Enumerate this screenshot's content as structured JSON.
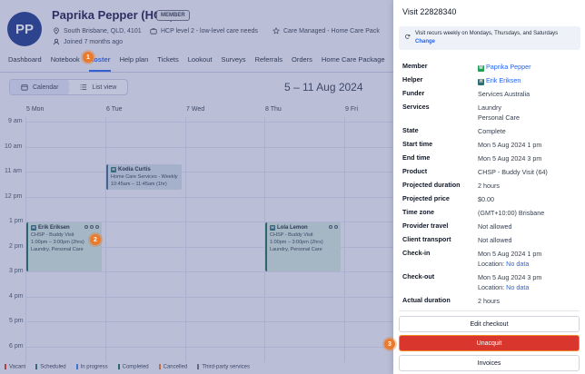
{
  "profile": {
    "initials": "PP",
    "name": "Paprika Pepper (HCP)",
    "badge": "MEMBER",
    "location": "South Brisbane, QLD, 4101",
    "care_level": "HCP level 2 - low-level care needs",
    "program": "Care Managed - Home Care Pack",
    "joined": "Joined 7 months ago"
  },
  "tabs": [
    "Dashboard",
    "Notebook",
    "Roster",
    "Help plan",
    "Tickets",
    "Lookout",
    "Surveys",
    "Referrals",
    "Orders",
    "Home Care Package"
  ],
  "active_tab": "Roster",
  "view_toggle": {
    "calendar": "Calendar",
    "list": "List view"
  },
  "week_title": "5 – 11 Aug 2024",
  "days": [
    "5 Mon",
    "6 Tue",
    "7 Wed",
    "8 Thu",
    "9 Fri"
  ],
  "hours": [
    "9 am",
    "10 am",
    "11 am",
    "12 pm",
    "1 pm",
    "2 pm",
    "3 pm",
    "4 pm",
    "5 pm",
    "6 pm"
  ],
  "events": [
    {
      "title": "Kodia Curtis",
      "line1": "Home Care Services - Weekly",
      "line2": "10:45am – 11:45am (1hr)",
      "line3": ""
    },
    {
      "title": "Erik Eriksen",
      "line1": "CHSP - Buddy Visit",
      "line2": "1:00pm – 3:00pm (2hrs)",
      "line3": "Laundry, Personal Care"
    },
    {
      "title": "Lola Lemon",
      "line1": "CHSP - Buddy Visit",
      "line2": "1:00pm – 3:00pm (2hrs)",
      "line3": "Laundry, Personal Care"
    }
  ],
  "legend": [
    {
      "label": "Vacant",
      "color": "#d9372d"
    },
    {
      "label": "Scheduled",
      "color": "#2f6f73"
    },
    {
      "label": "In progress",
      "color": "#3b82f6"
    },
    {
      "label": "Completed",
      "color": "#1f6d5b"
    },
    {
      "label": "Cancelled",
      "color": "#ea7b2c"
    },
    {
      "label": "Third-party services",
      "color": "#6b7280"
    }
  ],
  "step_badges": [
    "1",
    "2",
    "3"
  ],
  "visit": {
    "title": "Visit 22828340",
    "recur_text": "Visit recurs weekly on Mondays, Thursdays, and Saturdays",
    "recur_change": "Change",
    "member_badge": "M",
    "helper_badge": "H",
    "fields": [
      {
        "label": "Member",
        "value": "Paprika Pepper"
      },
      {
        "label": "Helper",
        "value": "Erik Eriksen"
      },
      {
        "label": "Funder",
        "value": "Services Australia"
      },
      {
        "label": "Services",
        "value": "Laundry",
        "value2": "Personal Care"
      },
      {
        "label": "State",
        "value": "Complete"
      },
      {
        "label": "Start time",
        "value": "Mon 5 Aug 2024 1 pm"
      },
      {
        "label": "End time",
        "value": "Mon 5 Aug 2024 3 pm"
      },
      {
        "label": "Product",
        "value": "CHSP - Buddy Visit (64)"
      },
      {
        "label": "Projected duration",
        "value": "2 hours"
      },
      {
        "label": "Projected price",
        "value": "$0.00"
      },
      {
        "label": "Time zone",
        "value": "(GMT+10:00) Brisbane"
      },
      {
        "label": "Provider travel",
        "value": "Not allowed"
      },
      {
        "label": "Client transport",
        "value": "Not allowed"
      },
      {
        "label": "Check-in",
        "value": "Mon 5 Aug 2024 1 pm",
        "value2_label": "Location:",
        "value2_link": "No data"
      },
      {
        "label": "Check-out",
        "value": "Mon 5 Aug 2024 3 pm",
        "value2_label": "Location:",
        "value2_link": "No data"
      },
      {
        "label": "Actual duration",
        "value": "2 hours"
      }
    ],
    "buttons": {
      "edit_checkout": "Edit checkout",
      "unacquit": "Unacquit",
      "invoices": "Invoices"
    }
  },
  "colors": {
    "accent": "#2563eb",
    "danger": "#d9372d",
    "highlight": "#ea7b2c",
    "member_badge": "#22a05a",
    "helper_badge": "#2f6f73"
  }
}
